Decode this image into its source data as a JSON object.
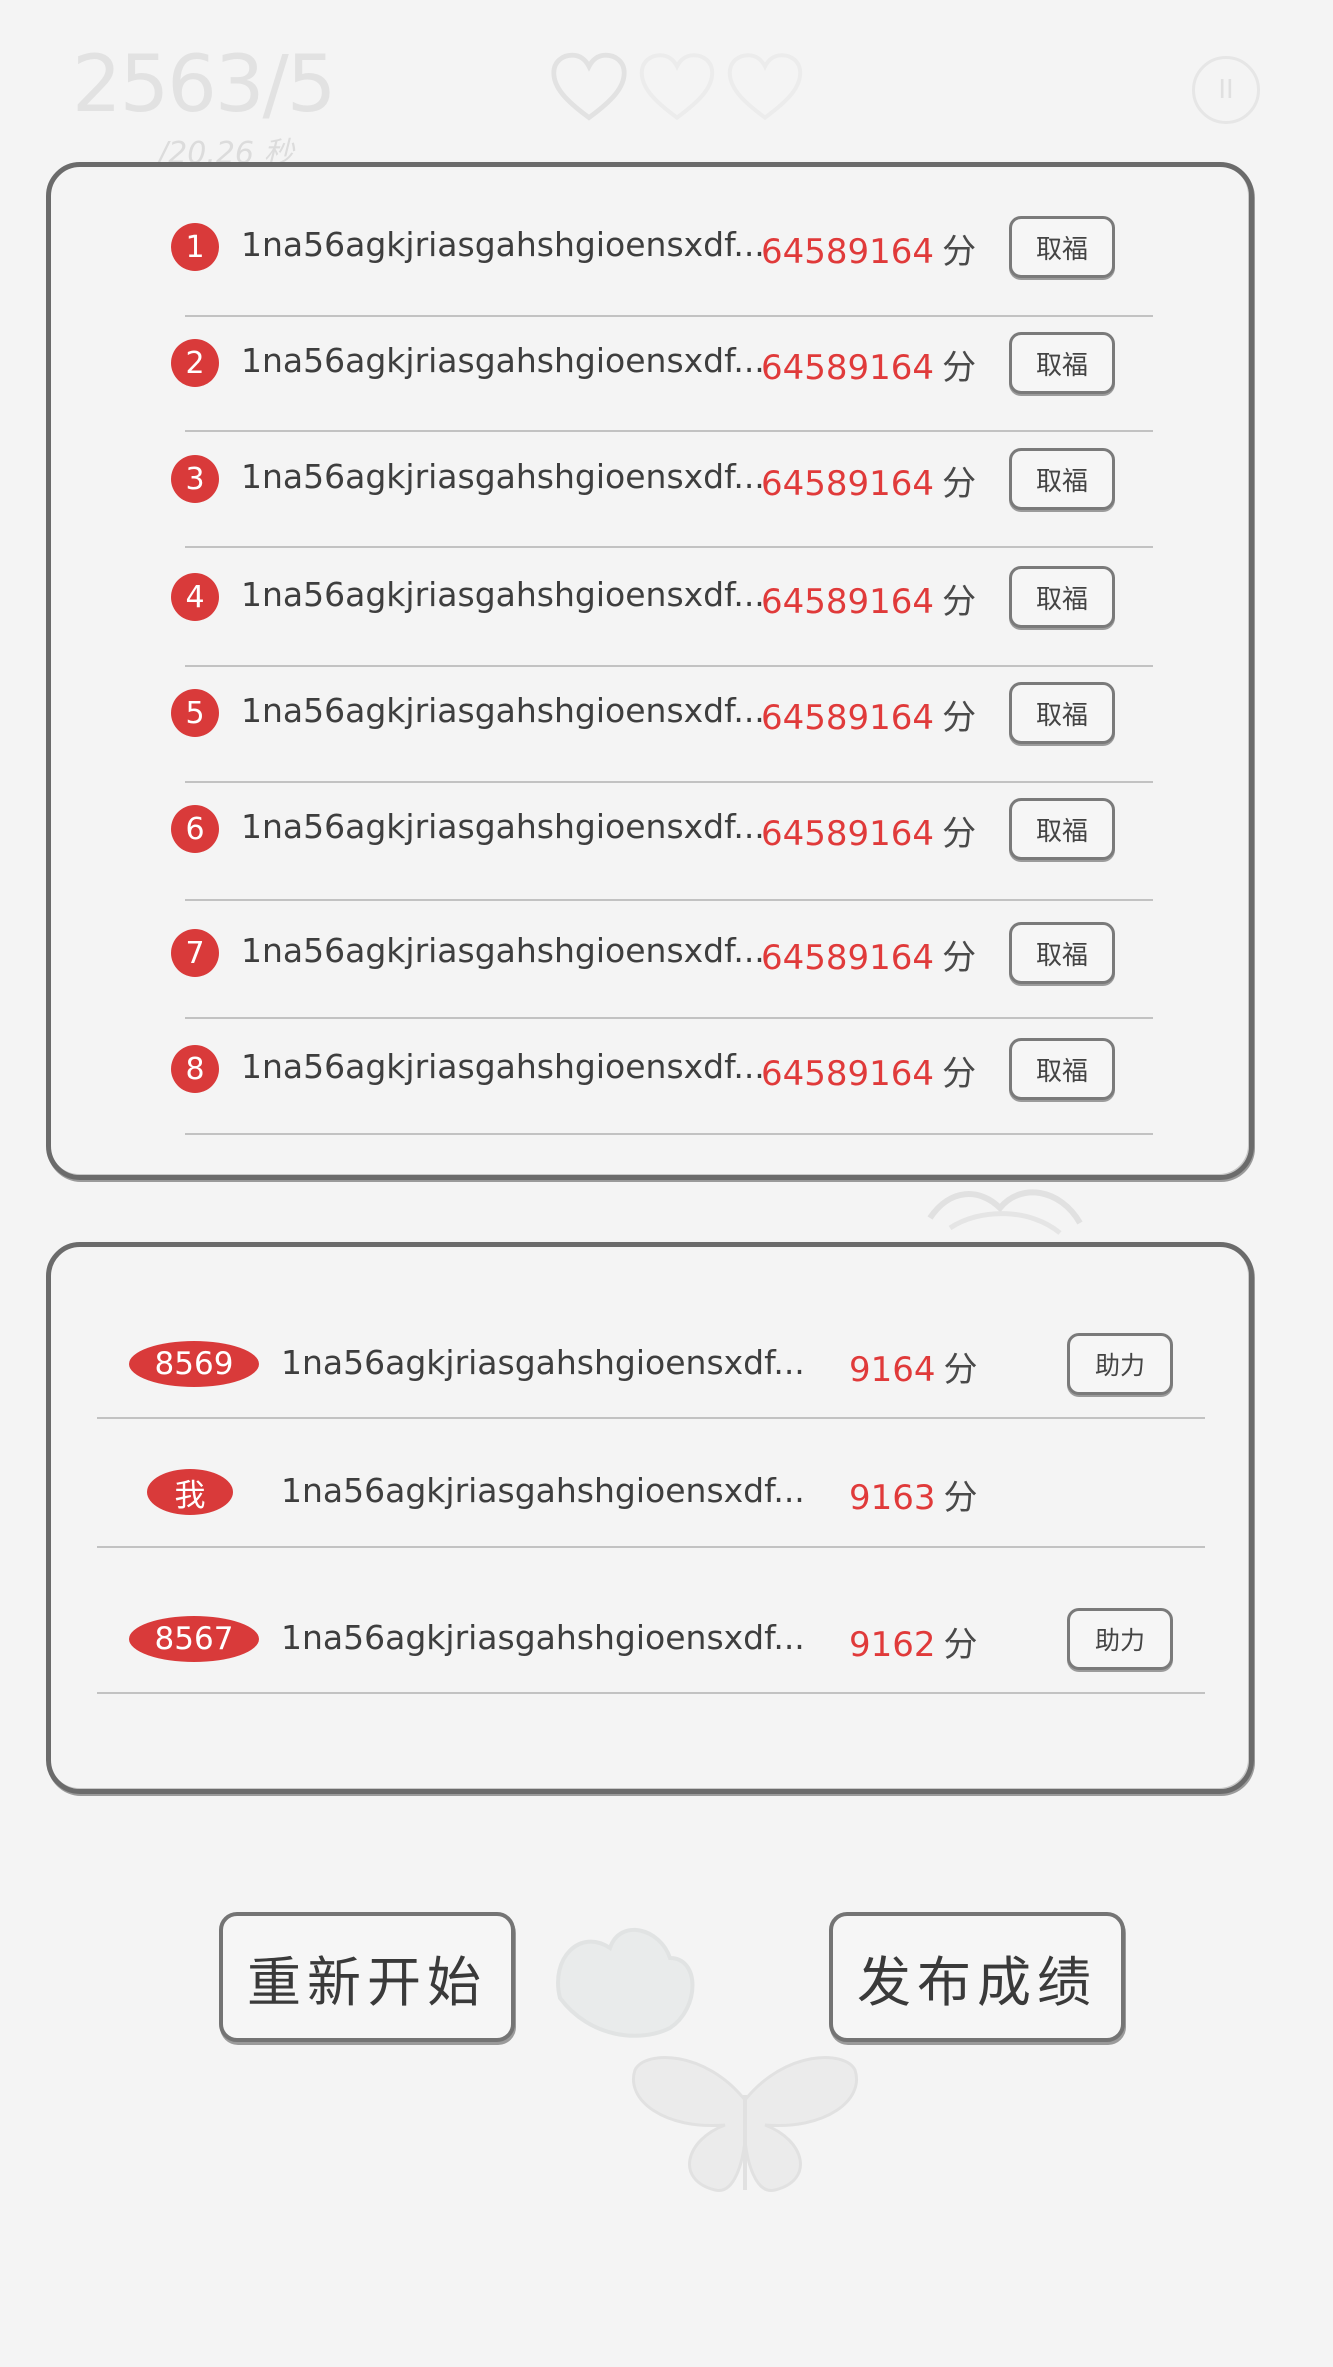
{
  "hud": {
    "score": "2563/5",
    "time": "/20.26 秒",
    "pause_label": "II"
  },
  "leaderboard": {
    "rows": [
      {
        "rank": "1",
        "name": "1na56agkjriasgahshgioensxdf...",
        "score": "64589164",
        "unit": "分",
        "button": "取福"
      },
      {
        "rank": "2",
        "name": "1na56agkjriasgahshgioensxdf...",
        "score": "64589164",
        "unit": "分",
        "button": "取福"
      },
      {
        "rank": "3",
        "name": "1na56agkjriasgahshgioensxdf...",
        "score": "64589164",
        "unit": "分",
        "button": "取福"
      },
      {
        "rank": "4",
        "name": "1na56agkjriasgahshgioensxdf...",
        "score": "64589164",
        "unit": "分",
        "button": "取福"
      },
      {
        "rank": "5",
        "name": "1na56agkjriasgahshgioensxdf...",
        "score": "64589164",
        "unit": "分",
        "button": "取福"
      },
      {
        "rank": "6",
        "name": "1na56agkjriasgahshgioensxdf...",
        "score": "64589164",
        "unit": "分",
        "button": "取福"
      },
      {
        "rank": "7",
        "name": "1na56agkjriasgahshgioensxdf...",
        "score": "64589164",
        "unit": "分",
        "button": "取福"
      },
      {
        "rank": "8",
        "name": "1na56agkjriasgahshgioensxdf...",
        "score": "64589164",
        "unit": "分",
        "button": "取福"
      }
    ]
  },
  "nearby": {
    "rows": [
      {
        "rank": "8569",
        "name": "1na56agkjriasgahshgioensxdf...",
        "score": "9164",
        "unit": "分",
        "button": "助力"
      },
      {
        "rank": "我",
        "name": "1na56agkjriasgahshgioensxdf...",
        "score": "9163",
        "unit": "分",
        "button": ""
      },
      {
        "rank": "8567",
        "name": "1na56agkjriasgahshgioensxdf...",
        "score": "9162",
        "unit": "分",
        "button": "助力"
      }
    ]
  },
  "actions": {
    "restart_label": "重新开始",
    "publish_label": "发布成绩"
  },
  "colors": {
    "accent_red": "#d93a3a",
    "border_gray": "#6b6b6b",
    "background": "#f4f4f4"
  },
  "icons": [
    "heart-icon",
    "pause-icon",
    "lotus-decoration",
    "butterfly-decoration"
  ]
}
